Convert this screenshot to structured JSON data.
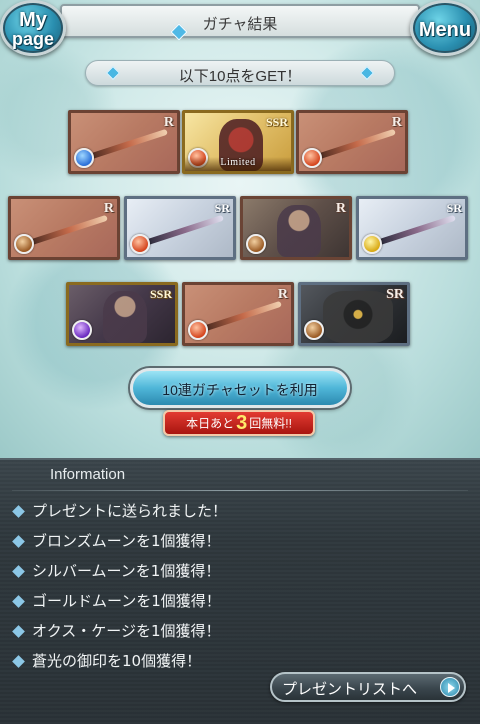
{
  "header": {
    "title": "ガチャ結果",
    "mypage_line1": "My",
    "mypage_line2": "page",
    "menu_label": "Menu"
  },
  "result_banner": "以下10点をGET！",
  "items": [
    {
      "rarity": "R",
      "kind": "weapon",
      "element": "water"
    },
    {
      "rarity": "SSR",
      "kind": "summon",
      "element": "fire",
      "tag": "Limited"
    },
    {
      "rarity": "R",
      "kind": "weapon",
      "element": "fire"
    },
    {
      "rarity": "R",
      "kind": "weapon",
      "element": "earth"
    },
    {
      "rarity": "SR",
      "kind": "weapon",
      "element": "fire"
    },
    {
      "rarity": "R",
      "kind": "character",
      "element": "earth"
    },
    {
      "rarity": "SR",
      "kind": "weapon",
      "element": "light"
    },
    {
      "rarity": "SSR",
      "kind": "character",
      "element": "dark"
    },
    {
      "rarity": "R",
      "kind": "weapon",
      "element": "fire"
    },
    {
      "rarity": "SR",
      "kind": "summon",
      "element": "earth"
    }
  ],
  "gacha_button": {
    "label": "10連ガチャセットを利用",
    "free_prefix": "本日あと",
    "free_count": "3",
    "free_suffix": "回無料!!"
  },
  "info": {
    "title": "Information",
    "messages": [
      "プレゼントに送られました！",
      "ブロンズムーンを1個獲得！",
      "シルバームーンを1個獲得！",
      "ゴールドムーンを1個獲得！",
      "オクス・ケージを1個獲得！",
      "蒼光の御印を10個獲得！"
    ],
    "present_button": "プレゼントリストへ"
  },
  "colors": {
    "accent": "#4fb6d8",
    "badge_red": "#c8221a",
    "info_bg": "#2f383d"
  }
}
